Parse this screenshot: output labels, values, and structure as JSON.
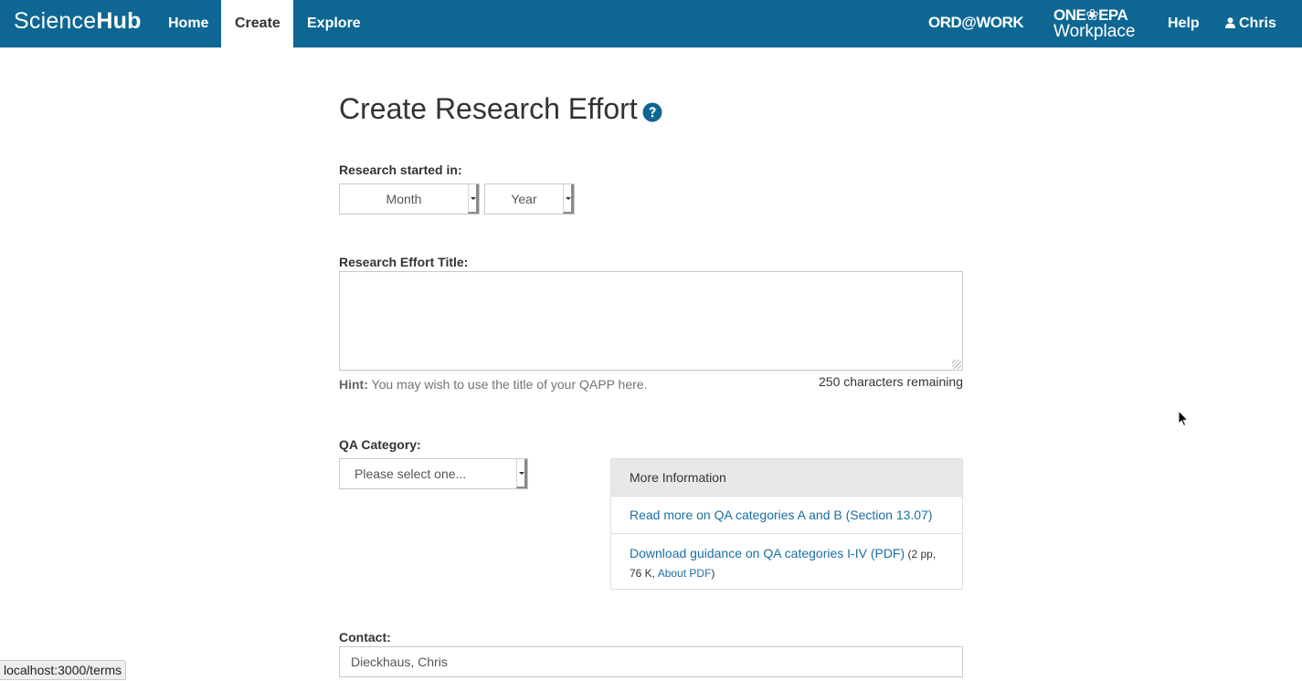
{
  "navbar": {
    "brand_part1": "Science",
    "brand_part2": "Hub",
    "home": "Home",
    "create": "Create",
    "explore": "Explore",
    "ordwork": "ORD@WORK",
    "oneepa_line1": "ONE❀EPA",
    "oneepa_line2": "Workplace",
    "help": "Help",
    "user": "Chris",
    "bg_color": "#0e6793"
  },
  "page": {
    "title": "Create Research Effort"
  },
  "research_started": {
    "label": "Research started in:",
    "month_value": "Month",
    "year_value": "Year"
  },
  "title_field": {
    "label": "Research Effort Title:",
    "hint_bold": "Hint:",
    "hint_text": " You may wish to use the title of your QAPP here.",
    "chars_remaining": "250 characters remaining"
  },
  "qa_category": {
    "label": "QA Category:",
    "select_value": "Please select one..."
  },
  "more_info": {
    "heading": "More Information",
    "link1": "Read more on QA categories A and B (Section 13.07)",
    "link2": "Download guidance on QA categories I-IV (PDF)",
    "link2_meta_prefix": " (2 pp, 76 K, ",
    "about_pdf": "About PDF",
    "link2_meta_suffix": ")"
  },
  "contact": {
    "label": "Contact:",
    "value": "Dieckhaus, Chris"
  },
  "status_bar": {
    "url": "localhost:3000/terms"
  }
}
